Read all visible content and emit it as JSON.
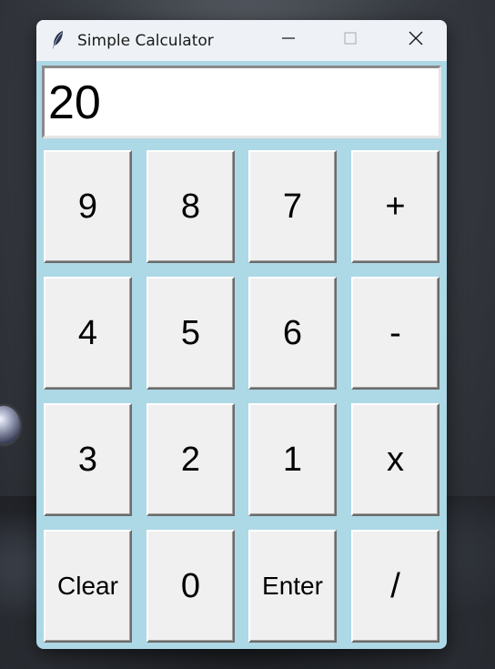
{
  "window": {
    "title": "Simple Calculator",
    "icons": {
      "app": "feather-icon",
      "minimize": "minimize-icon",
      "maximize": "maximize-icon",
      "close": "close-icon"
    }
  },
  "display": {
    "value": "20"
  },
  "keys": {
    "row1": [
      "9",
      "8",
      "7",
      "+"
    ],
    "row2": [
      "4",
      "5",
      "6",
      "-"
    ],
    "row3": [
      "3",
      "2",
      "1",
      "x"
    ],
    "row4": [
      "Clear",
      "0",
      "Enter",
      "/"
    ]
  },
  "colors": {
    "window_bg": "#add8e6",
    "key_bg": "#f0f0f0",
    "titlebar_bg": "#eef2f6"
  }
}
